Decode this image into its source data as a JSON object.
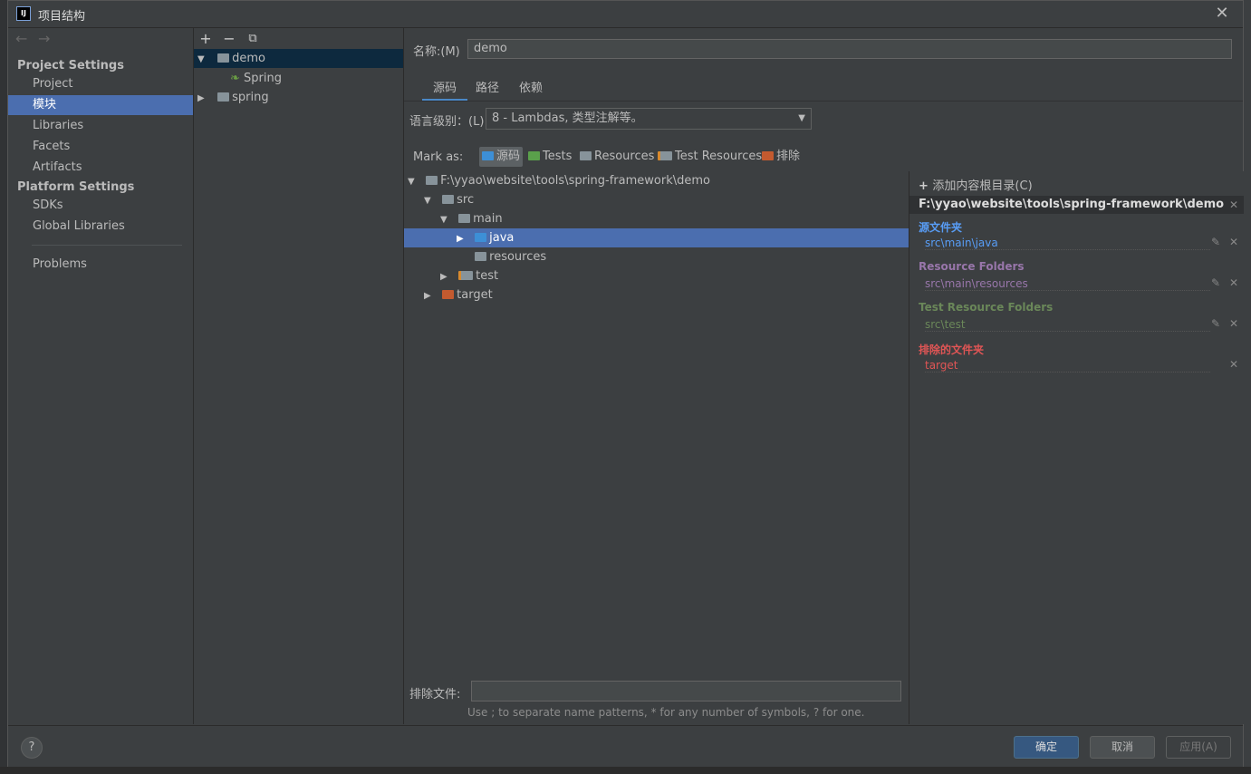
{
  "title": "项目结构",
  "nav": {
    "back": "←",
    "forward": "→",
    "project_settings": "Project Settings",
    "items_project": [
      "Project",
      "模块",
      "Libraries",
      "Facets",
      "Artifacts"
    ],
    "platform_settings": "Platform Settings",
    "items_platform": [
      "SDKs",
      "Global Libraries"
    ],
    "problems": "Problems",
    "selected": "模块"
  },
  "modules": {
    "toolbar": {
      "add": "+",
      "remove": "−",
      "copy": "⧉"
    },
    "tree": [
      {
        "label": "demo",
        "expanded": true,
        "selected": true
      },
      {
        "label": "Spring",
        "child": true
      },
      {
        "label": "spring",
        "expanded": false
      }
    ]
  },
  "config": {
    "name_label": "名称:(M)",
    "name_value": "demo",
    "tabs": [
      "源码",
      "路径",
      "依赖"
    ],
    "active_tab": "源码",
    "lang_label": "语言级别：(L)",
    "lang_value": "8 - Lambdas, 类型注解等。",
    "mark_as_label": "Mark as:",
    "mark_buttons": [
      "源码",
      "Tests",
      "Resources",
      "Test Resources",
      "排除"
    ],
    "folder_tree": [
      {
        "label": "F:\\yyao\\website\\tools\\spring-framework\\demo",
        "depth": 0,
        "arrow": "▼"
      },
      {
        "label": "src",
        "depth": 1,
        "arrow": "▼"
      },
      {
        "label": "main",
        "depth": 2,
        "arrow": "▼"
      },
      {
        "label": "java",
        "depth": 3,
        "arrow": "▶",
        "selected": true
      },
      {
        "label": "resources",
        "depth": 3,
        "arrow": ""
      },
      {
        "label": "test",
        "depth": 2,
        "arrow": "▶"
      },
      {
        "label": "target",
        "depth": 1,
        "arrow": "▶"
      }
    ],
    "exclude_label": "排除文件:",
    "exclude_value": "",
    "hint": "Use ; to separate name patterns, * for any number of symbols, ? for one."
  },
  "roots": {
    "add_label": "添加内容根目录(C)",
    "path": "F:\\yyao\\website\\tools\\spring-framework\\demo",
    "groups": [
      {
        "title": "源文件夹",
        "entry": "src\\main\\java",
        "color": "#589df6"
      },
      {
        "title": "Resource Folders",
        "entry": "src\\main\\resources",
        "color": "#9876aa"
      },
      {
        "title": "Test Resource Folders",
        "entry": "src\\test",
        "color": "#6a8759"
      },
      {
        "title": "排除的文件夹",
        "entry": "target",
        "color": "#e05555"
      }
    ]
  },
  "footer": {
    "help": "?",
    "ok": "确定",
    "cancel": "取消",
    "apply": "应用(A)"
  }
}
